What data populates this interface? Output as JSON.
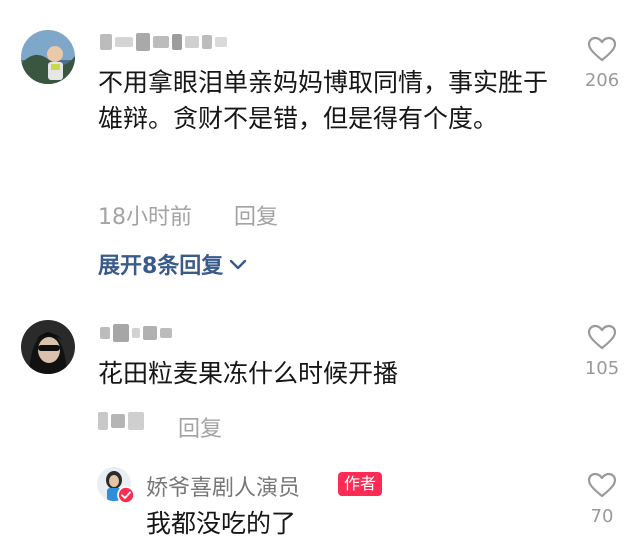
{
  "comments": [
    {
      "text": "不用拿眼泪单亲妈妈博取同情，事实胜于雄辩。贪财不是错，但是得有个度。",
      "time": "18小时前",
      "reply_label": "回复",
      "likes": "206",
      "expand_label": "展开8条回复",
      "expand_icon": "chevron-down-icon"
    },
    {
      "text": "花田粒麦果冻什么时候开播",
      "reply_label": "回复",
      "likes": "105",
      "reply": {
        "author": "娇爷喜剧人演员",
        "badge": "作者",
        "text": "我都没吃的了",
        "likes": "70"
      }
    }
  ],
  "colors": {
    "expand_link": "#3a5a8c",
    "badge": "#fe2c55",
    "meta_text": "#a3a3a3"
  }
}
